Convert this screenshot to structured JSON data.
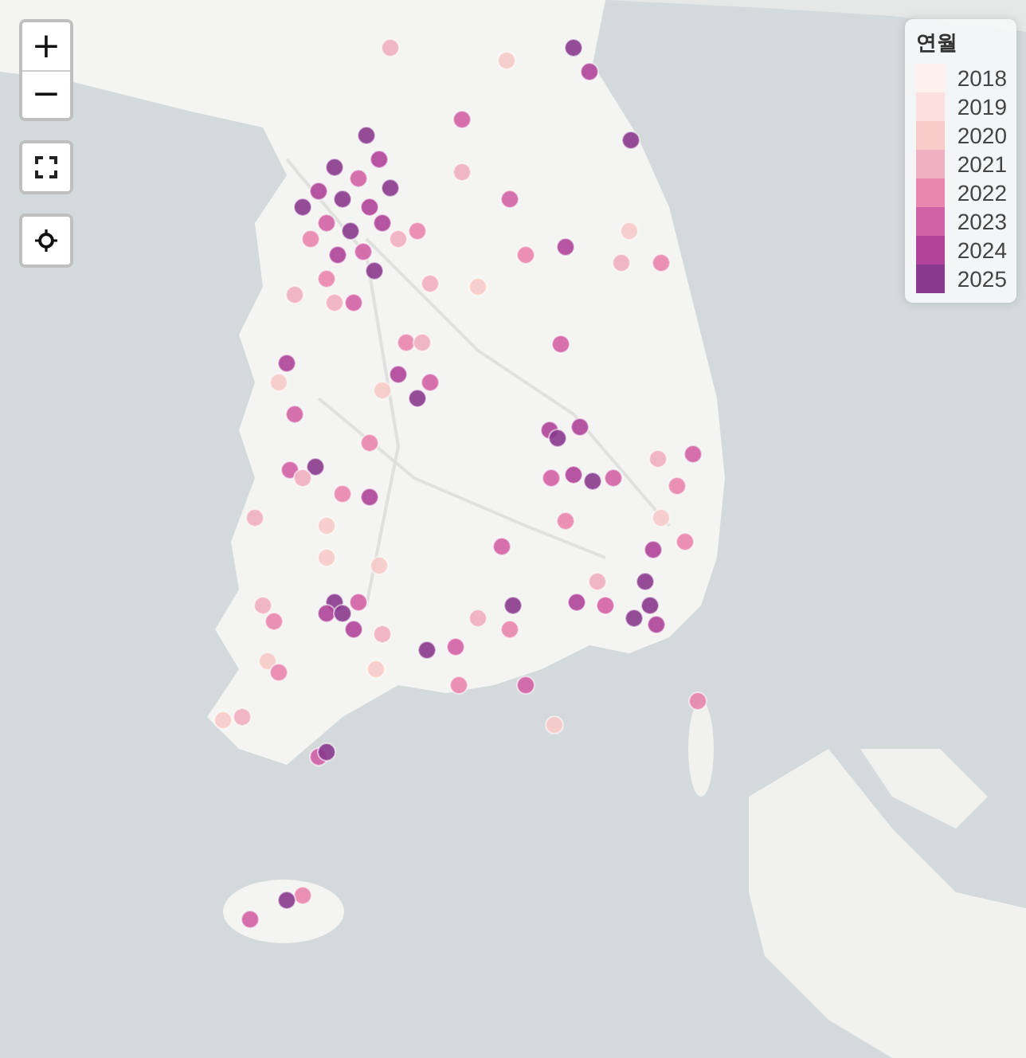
{
  "controls": [
    {
      "kind": "zoom-in",
      "label": "+"
    },
    {
      "kind": "zoom-out",
      "label": "−"
    },
    {
      "kind": "fullscreen"
    },
    {
      "kind": "locate"
    }
  ],
  "legend": {
    "title": "연월",
    "items": [
      {
        "label": "2018",
        "color": "#fdf1ee"
      },
      {
        "label": "2019",
        "color": "#fbe0df"
      },
      {
        "label": "2020",
        "color": "#f7cbc8"
      },
      {
        "label": "2021",
        "color": "#f1b0c2"
      },
      {
        "label": "2022",
        "color": "#e886ad"
      },
      {
        "label": "2023",
        "color": "#d262a6"
      },
      {
        "label": "2024",
        "color": "#b0449a"
      },
      {
        "label": "2025",
        "color": "#8a3a8e"
      }
    ]
  }
}
